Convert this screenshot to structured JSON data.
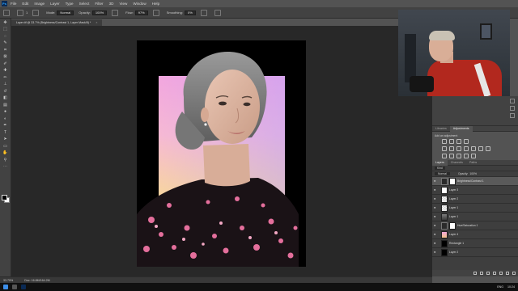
{
  "menubar": {
    "logo": "Ps",
    "items": [
      "File",
      "Edit",
      "Image",
      "Layer",
      "Type",
      "Select",
      "Filter",
      "3D",
      "View",
      "Window",
      "Help"
    ]
  },
  "options": {
    "brush_size": "1",
    "mode_label": "Mode:",
    "mode_value": "Normal",
    "opacity_label": "Opacity:",
    "opacity_value": "100%",
    "flow_label": "Flow:",
    "flow_value": "97%",
    "smoothing_label": "Smoothing:",
    "smoothing_value": "0%"
  },
  "document": {
    "tab_title": "Layer.tif @ 33.7% (Brightness/Contrast 1, Layer Mask/8) *",
    "close": "×"
  },
  "status": {
    "zoom": "33.79%",
    "doc_size": "Doc: 16.8M/164.2M"
  },
  "adjustments": {
    "tabs": [
      "Libraries",
      "Adjustments"
    ],
    "add_label": "Add an adjustment"
  },
  "layers": {
    "tabs": [
      "Layers",
      "Channels",
      "Paths"
    ],
    "kind_label": "Kind",
    "mode_value": "Normal",
    "opacity_label": "Opacity:",
    "opacity_value": "100%",
    "items": [
      {
        "name": "Brightness/Contrast 1",
        "thumb": "adj",
        "selected": true
      },
      {
        "name": "Layer 3",
        "thumb": "white",
        "selected": false
      },
      {
        "name": "Layer 2",
        "thumb": "checker",
        "selected": false
      },
      {
        "name": "Layer 1",
        "thumb": "checker",
        "selected": false
      },
      {
        "name": "Layer 1",
        "thumb": "photo",
        "selected": false
      },
      {
        "name": "Hue/Saturation 1",
        "thumb": "adj",
        "selected": false
      },
      {
        "name": "Layer 4",
        "thumb": "pink",
        "selected": false
      },
      {
        "name": "Rectangle 1",
        "thumb": "black",
        "selected": false
      },
      {
        "name": "Layer 2",
        "thumb": "black",
        "selected": false
      }
    ]
  },
  "taskbar": {
    "language": "ENG",
    "time": "10:24"
  }
}
